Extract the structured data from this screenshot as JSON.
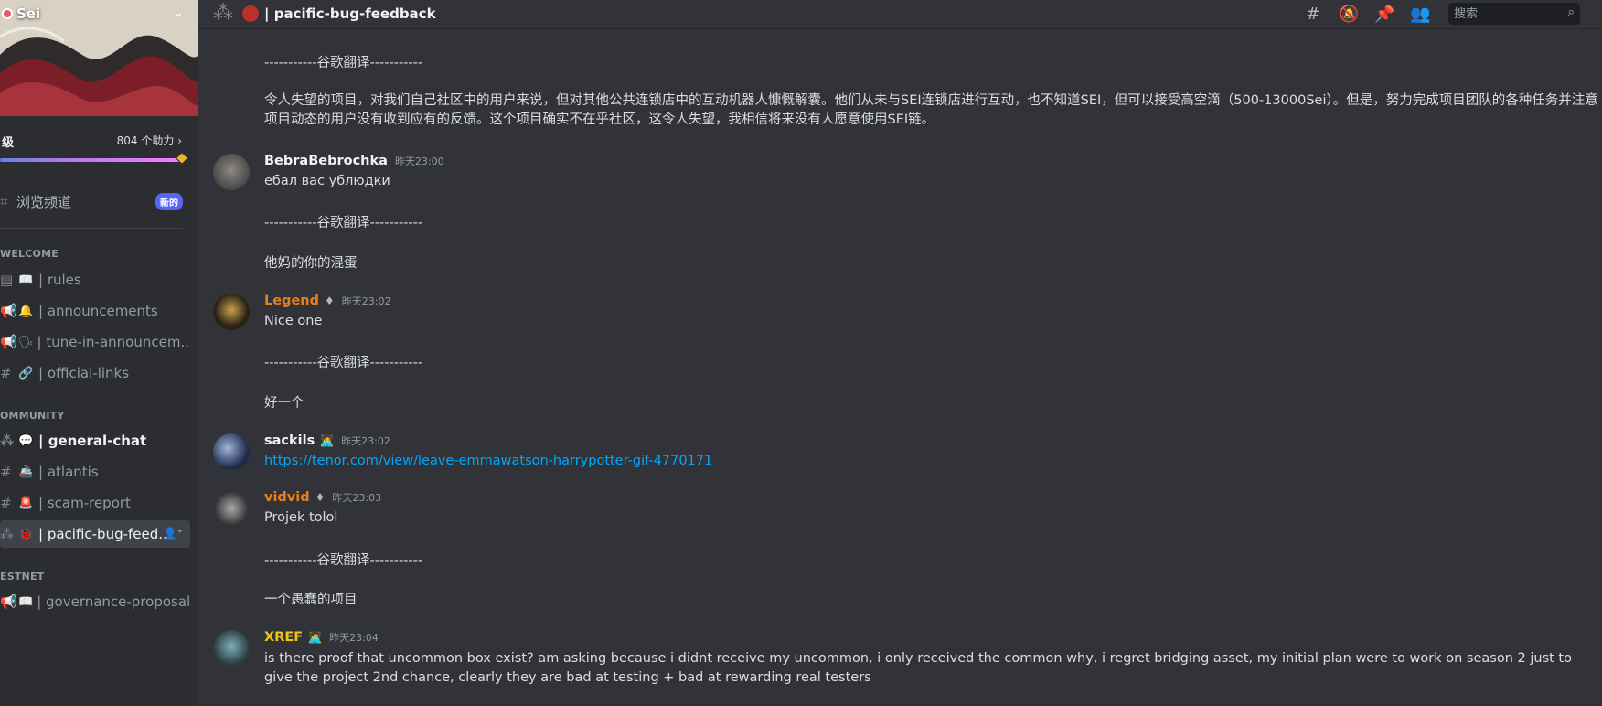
{
  "server": {
    "name": "Sei",
    "boost_level": "级",
    "boost_count": "804 个助力",
    "browse_channels": "浏览频道",
    "new_badge": "新的"
  },
  "sidebar": {
    "categories": {
      "welcome": "WELCOME",
      "community": "OMMUNITY",
      "testnet": "ESTNET"
    },
    "channels": [
      {
        "label": "| rules",
        "emoji": "📖"
      },
      {
        "label": "| announcements",
        "emoji": "🔔"
      },
      {
        "label": "| tune-in-announcem...",
        "emoji": "🗣"
      },
      {
        "label": "| official-links",
        "emoji": "🔗"
      },
      {
        "label": "| general-chat",
        "emoji": "💬"
      },
      {
        "label": "| atlantis",
        "emoji": "🚢"
      },
      {
        "label": "| scam-report",
        "emoji": "🚨"
      },
      {
        "label": "| pacific-bug-feed...",
        "emoji": "🐞"
      },
      {
        "label": "| governance-proposals",
        "emoji": "📖"
      }
    ]
  },
  "header": {
    "channel_title": "| pacific-bug-feedback",
    "search_placeholder": "搜索"
  },
  "messages": [
    {
      "type": "text",
      "text": "-----------谷歌翻译-----------"
    },
    {
      "type": "text",
      "text": "令人失望的项目，对我们自己社区中的用户来说，但对其他公共连锁店中的互动机器人慷慨解囊。他们从未与SEI连锁店进行互动，也不知道SEI，但可以接受高空滴（500-13000Sei）。但是，努力完成项目团队的各种任务并注意项目动态的用户没有收到应有的反馈。这个项目确实不在乎社区，这令人失望，我相信将来没有人愿意使用SEI链。"
    },
    {
      "type": "post",
      "user": "BebraBebrochka",
      "time": "昨天23:00",
      "color": "#f2f3f5",
      "text": "ебал вас ублюдки"
    },
    {
      "type": "text",
      "text": "-----------谷歌翻译-----------"
    },
    {
      "type": "text",
      "text": "他妈的你的混蛋"
    },
    {
      "type": "post",
      "user": "Legend",
      "time": "昨天23:02",
      "color": "#e67e22",
      "text": "Nice one"
    },
    {
      "type": "text",
      "text": "-----------谷歌翻译-----------"
    },
    {
      "type": "text",
      "text": "好一个"
    },
    {
      "type": "post",
      "user": "sackils",
      "time": "昨天23:02",
      "color": "#f2f3f5",
      "text": "https://tenor.com/view/leave-emmawatson-harrypotter-gif-4770171"
    },
    {
      "type": "post",
      "user": "vidvid",
      "time": "昨天23:03",
      "color": "#e67e22",
      "text": "Projek tolol"
    },
    {
      "type": "text",
      "text": "-----------谷歌翻译-----------"
    },
    {
      "type": "text",
      "text": "一个愚蠢的项目"
    },
    {
      "type": "post",
      "user": "XREF",
      "time": "昨天23:04",
      "color": "#f1c40f",
      "text": "is there proof that uncommon box exist? am asking because i didnt receive my uncommon, i only received the common why, i regret bridging asset, my initial plan were to work on season 2 just to give the project 2nd chance, clearly they are bad at testing + bad at rewarding real testers"
    }
  ],
  "boost_progress": 0.97
}
